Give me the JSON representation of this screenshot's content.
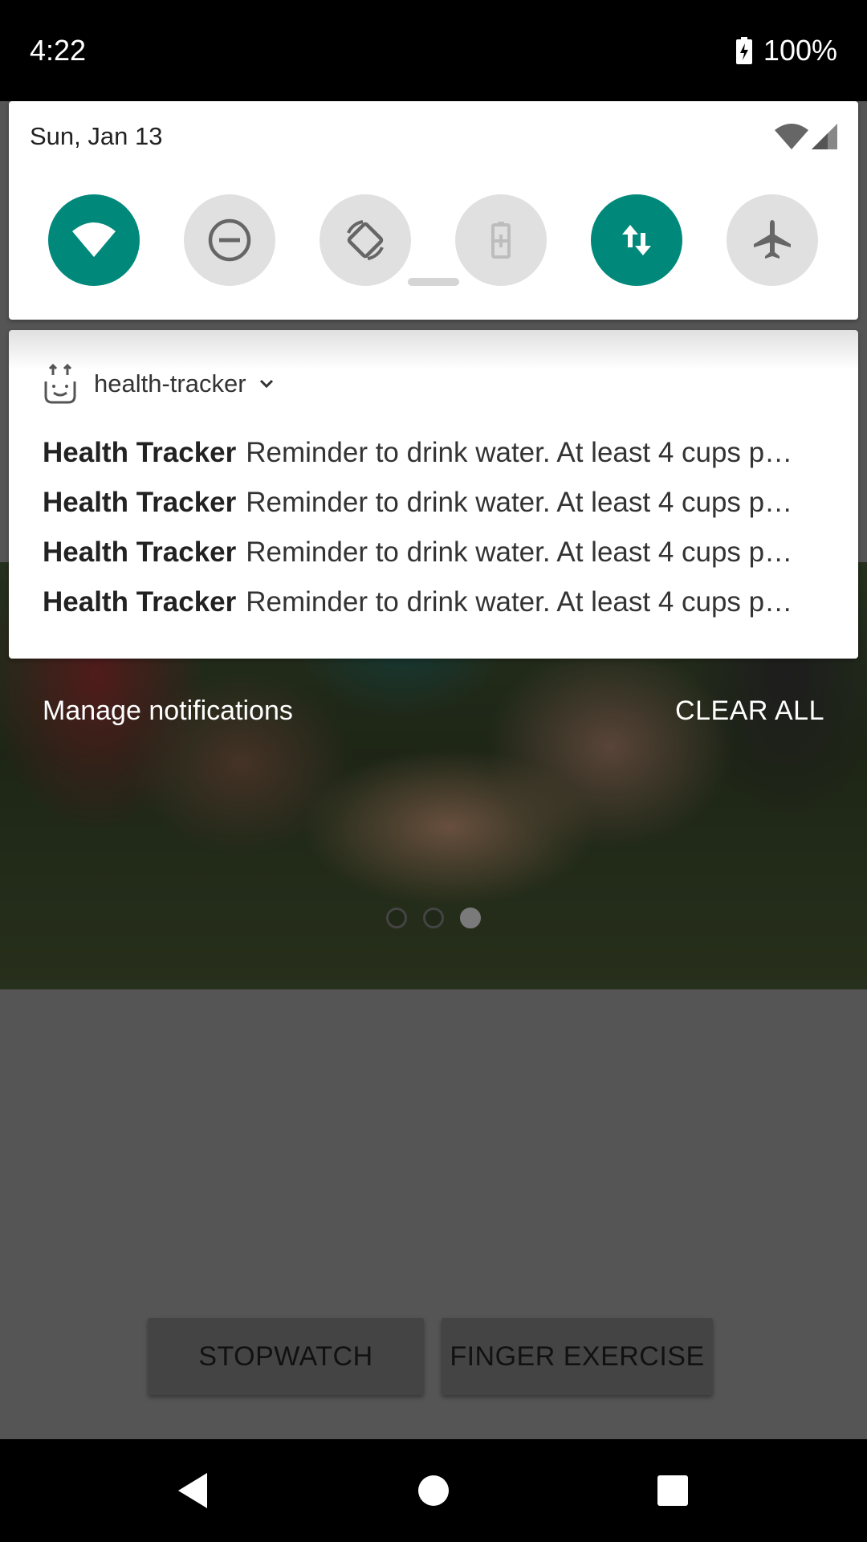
{
  "status_bar": {
    "time": "4:22",
    "battery": "100%"
  },
  "quick_settings": {
    "date": "Sun, Jan 13",
    "tiles": [
      {
        "name": "wifi",
        "state": "on",
        "icon": "wifi-icon"
      },
      {
        "name": "do-not-disturb",
        "state": "off",
        "icon": "dnd-icon"
      },
      {
        "name": "auto-rotate",
        "state": "off",
        "icon": "rotate-icon"
      },
      {
        "name": "battery-saver",
        "state": "off",
        "icon": "battery-saver-icon"
      },
      {
        "name": "mobile-data",
        "state": "on",
        "icon": "data-arrows-icon"
      },
      {
        "name": "airplane-mode",
        "state": "off",
        "icon": "airplane-icon"
      }
    ]
  },
  "notification": {
    "app_name": "health-tracker",
    "lines": [
      {
        "title": "Health Tracker",
        "text": "Reminder to drink water. At least 4 cups p…"
      },
      {
        "title": "Health Tracker",
        "text": "Reminder to drink water. At least 4 cups p…"
      },
      {
        "title": "Health Tracker",
        "text": "Reminder to drink water. At least 4 cups p…"
      },
      {
        "title": "Health Tracker",
        "text": "Reminder to drink water. At least 4 cups p…"
      }
    ]
  },
  "shade_footer": {
    "manage": "Manage notifications",
    "clear_all": "CLEAR ALL"
  },
  "app": {
    "buttons": {
      "stopwatch": "STOPWATCH",
      "finger_exercise": "FINGER EXERCISE"
    },
    "pager": {
      "count": 3,
      "active_index": 2
    }
  },
  "colors": {
    "accent": "#00897b",
    "tile_off": "#e0e0e0",
    "scrim": "#555555"
  }
}
